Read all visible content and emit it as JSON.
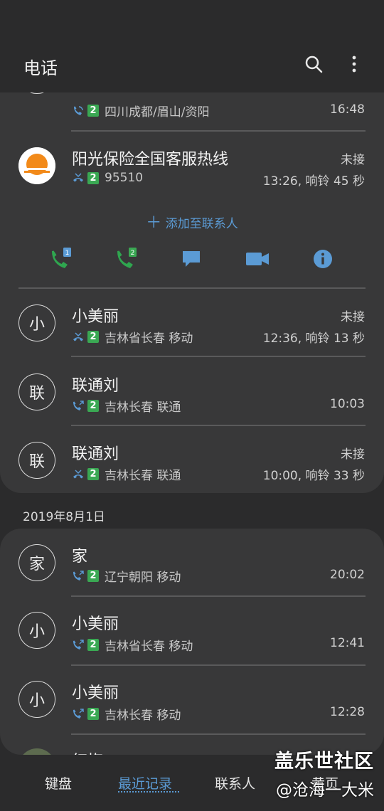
{
  "header": {
    "title": "电话"
  },
  "partial_top_row": {
    "location": "四川成都/眉山/资阳",
    "time": "16:48"
  },
  "expanded_entry": {
    "name": "阳光保险全国客服热线",
    "number": "95510",
    "status": "未接",
    "time": "13:26, 响铃 45 秒",
    "add_contact_label": "添加至联系人"
  },
  "rows_group1": [
    {
      "avatar": "小",
      "name": "小美丽",
      "location": "吉林省长春 移动",
      "status": "未接",
      "time": "12:36, 响铃 13 秒",
      "type": "missed"
    },
    {
      "avatar": "联",
      "name": "联通刘",
      "location": "吉林长春 联通",
      "status": "",
      "time": "10:03",
      "type": "outgoing"
    },
    {
      "avatar": "联",
      "name": "联通刘",
      "location": "吉林长春 联通",
      "status": "未接",
      "time": "10:00, 响铃 33 秒",
      "type": "missed"
    }
  ],
  "date_header": "2019年8月1日",
  "rows_group2": [
    {
      "avatar": "家",
      "name": "家",
      "location": "辽宁朝阳 移动",
      "time": "20:02",
      "type": "outgoing"
    },
    {
      "avatar": "小",
      "name": "小美丽",
      "location": "吉林省长春 移动",
      "time": "12:41",
      "type": "outgoing"
    },
    {
      "avatar": "小",
      "name": "小美丽",
      "location": "吉林长春 移动",
      "time": "12:28",
      "type": "outgoing"
    }
  ],
  "sim_label": "2",
  "partial_bottom_name": "红梅",
  "bottom_nav": {
    "keypad": "键盘",
    "recents": "最近记录",
    "contacts": "联系人",
    "other": "黄页"
  },
  "watermark": {
    "brand": "盖乐世社区",
    "user": "@沧海一大米"
  },
  "colors": {
    "accent": "#5b9bd5",
    "sim_green": "#3aa853",
    "call_green": "#2fa64f",
    "missed_icon": "#5b9bd5"
  }
}
